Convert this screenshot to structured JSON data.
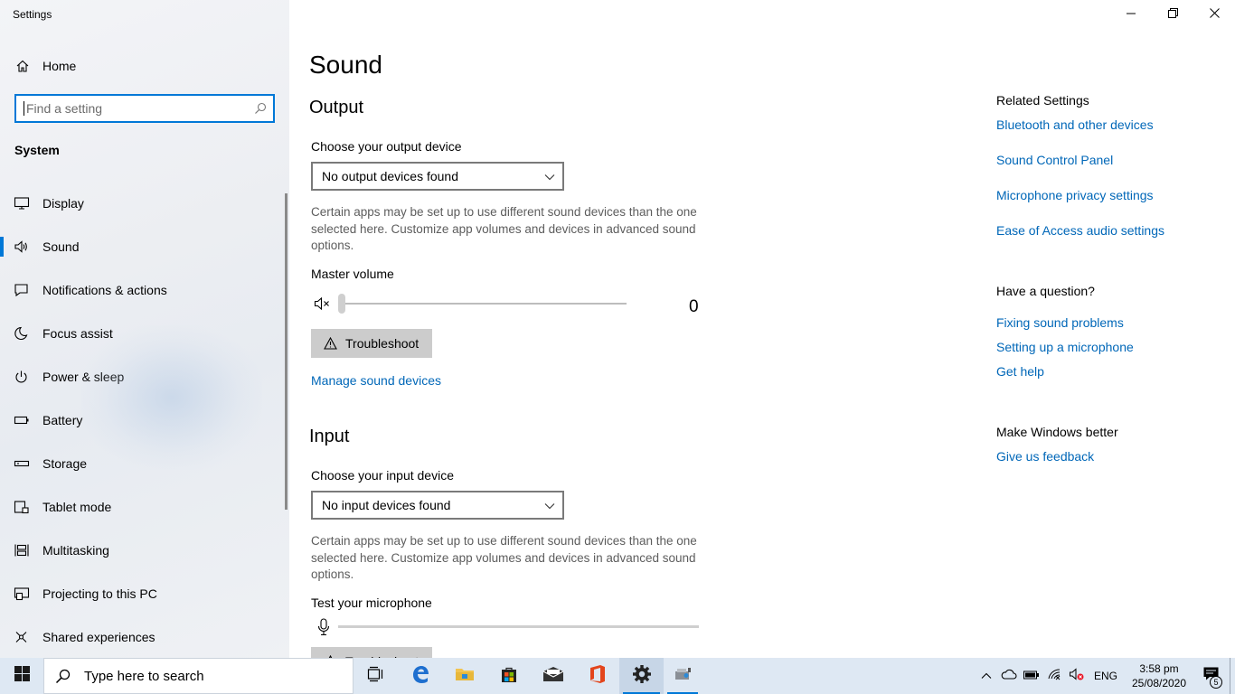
{
  "window": {
    "title": "Settings"
  },
  "sidebar": {
    "home_label": "Home",
    "search_placeholder": "Find a setting",
    "group_title": "System",
    "items": [
      {
        "label": "Display",
        "icon": "display-icon"
      },
      {
        "label": "Sound",
        "icon": "speaker-icon",
        "active": true
      },
      {
        "label": "Notifications & actions",
        "icon": "notification-icon"
      },
      {
        "label": "Focus assist",
        "icon": "moon-icon"
      },
      {
        "label": "Power & sleep",
        "icon": "power-icon"
      },
      {
        "label": "Battery",
        "icon": "battery-icon"
      },
      {
        "label": "Storage",
        "icon": "storage-icon"
      },
      {
        "label": "Tablet mode",
        "icon": "tablet-icon"
      },
      {
        "label": "Multitasking",
        "icon": "multitasking-icon"
      },
      {
        "label": "Projecting to this PC",
        "icon": "projecting-icon"
      },
      {
        "label": "Shared experiences",
        "icon": "shared-icon"
      }
    ]
  },
  "main": {
    "title": "Sound",
    "output": {
      "heading": "Output",
      "device_label": "Choose your output device",
      "device_value": "No output devices found",
      "description": "Certain apps may be set up to use different sound devices than the one selected here. Customize app volumes and devices in advanced sound options.",
      "volume_label": "Master volume",
      "volume_value": "0",
      "troubleshoot_label": "Troubleshoot",
      "manage_link": "Manage sound devices"
    },
    "input": {
      "heading": "Input",
      "device_label": "Choose your input device",
      "device_value": "No input devices found",
      "description": "Certain apps may be set up to use different sound devices than the one selected here. Customize app volumes and devices in advanced sound options.",
      "test_label": "Test your microphone"
    }
  },
  "related": {
    "heading": "Related Settings",
    "links": [
      "Bluetooth and other devices",
      "Sound Control Panel",
      "Microphone privacy settings",
      "Ease of Access audio settings"
    ],
    "question_heading": "Have a question?",
    "question_links": [
      "Fixing sound problems",
      "Setting up a microphone",
      "Get help"
    ],
    "better_heading": "Make Windows better",
    "better_link": "Give us feedback"
  },
  "taskbar": {
    "search_placeholder": "Type here to search",
    "language": "ENG",
    "time": "3:58 pm",
    "date": "25/08/2020",
    "notification_count": "5"
  },
  "colors": {
    "accent": "#0078d7",
    "link": "#0067b8",
    "taskbar": "#dee8f3"
  }
}
